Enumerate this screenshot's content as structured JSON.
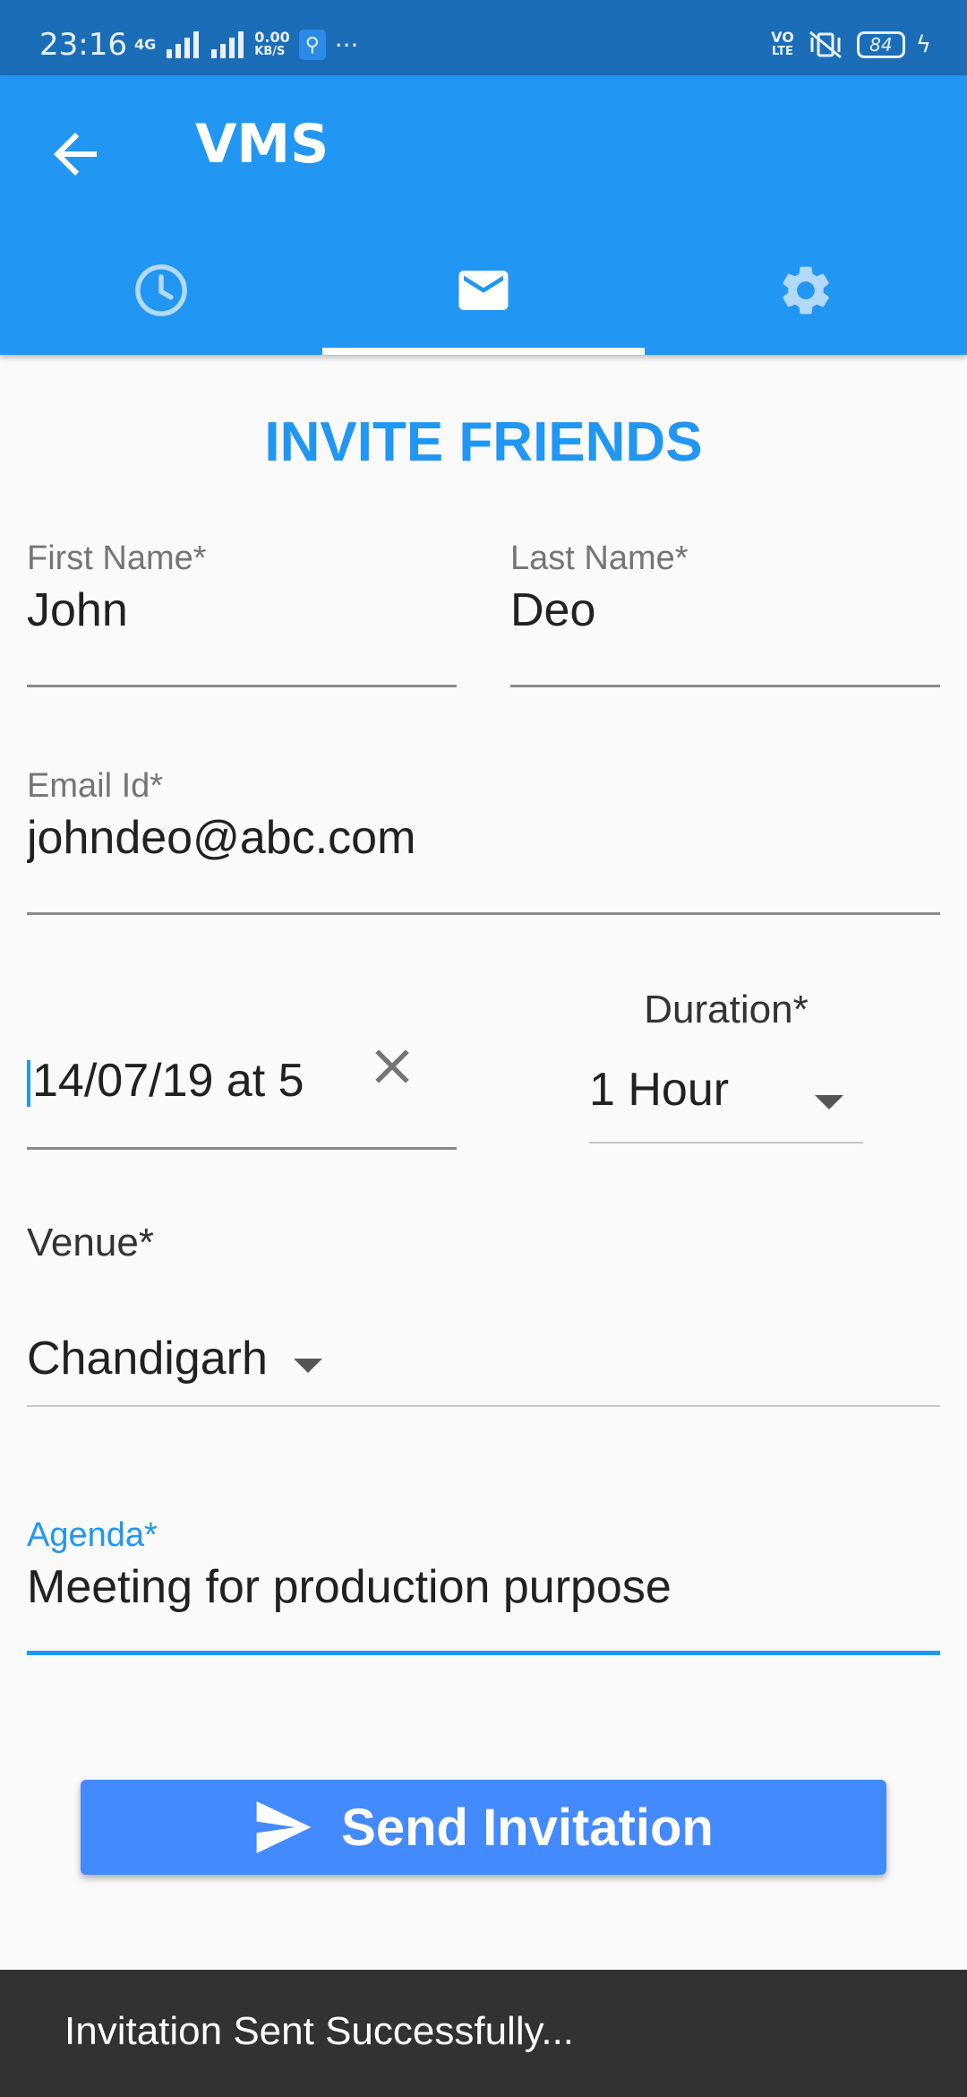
{
  "status_bar": {
    "time": "23:16",
    "network_label": "4G",
    "data_speed_value": "0.00",
    "data_speed_unit": "KB/S",
    "more": "···",
    "volte_top": "VO",
    "volte_bottom": "LTE",
    "battery": "84"
  },
  "app_bar": {
    "title": "VMS",
    "color": "#2196f3",
    "tabs": [
      {
        "icon": "clock-icon",
        "selected": false
      },
      {
        "icon": "mail-icon",
        "selected": true
      },
      {
        "icon": "gear-icon",
        "selected": false
      }
    ]
  },
  "form": {
    "title": "INVITE FRIENDS",
    "first_name_label": "First Name*",
    "first_name_value": "John",
    "last_name_label": "Last Name*",
    "last_name_value": "Deo",
    "email_label": "Email Id*",
    "email_value": "johndeo@abc.com",
    "datetime_value": "14/07/19 at 5",
    "duration_label": "Duration*",
    "duration_value": "1 Hour",
    "venue_label": "Venue*",
    "venue_value": "Chandigarh",
    "agenda_label": "Agenda*",
    "agenda_value": "Meeting for production purpose"
  },
  "send_button": {
    "label": "Send Invitation",
    "color": "#448aff"
  },
  "snackbar": {
    "message": "Invitation Sent Successfully..."
  }
}
